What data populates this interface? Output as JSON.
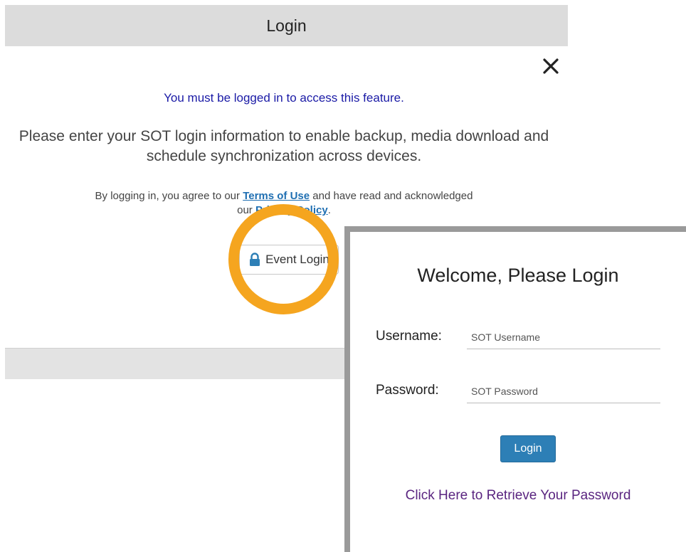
{
  "modal": {
    "header_title": "Login",
    "notice": "You must be logged in to access this feature.",
    "description": "Please enter your SOT login information to enable backup, media download and schedule synchronization across devices.",
    "agree_prefix": "By logging in, you agree to our ",
    "terms_link": "Terms of Use",
    "agree_middle": " and have read and acknowledged our ",
    "privacy_link": "Privacy Policy",
    "agree_suffix": ".",
    "event_login_label": "Event Login",
    "close_icon": "close-icon",
    "lock_icon": "lock-icon"
  },
  "login_panel": {
    "title": "Welcome, Please Login",
    "username_label": "Username:",
    "username_placeholder": "SOT Username",
    "password_label": "Password:",
    "password_placeholder": "SOT Password",
    "login_button": "Login",
    "retrieve_link": "Click Here to Retrieve Your Password"
  },
  "colors": {
    "highlight_ring": "#f5a51f",
    "login_button": "#2d7fb6",
    "link": "#1f6fb2",
    "notice": "#1a1aa6",
    "retrieve_link": "#5a2580"
  }
}
